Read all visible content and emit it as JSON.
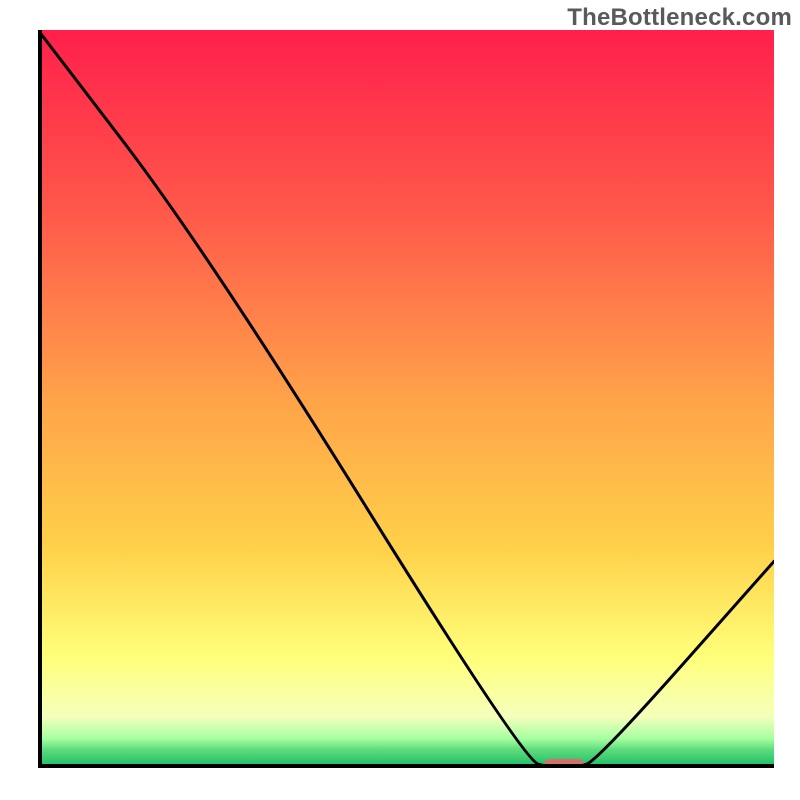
{
  "watermark": "TheBottleneck.com",
  "chart_data": {
    "type": "line",
    "title": "",
    "xlabel": "",
    "ylabel": "",
    "xlim": [
      0,
      100
    ],
    "ylim": [
      0,
      100
    ],
    "grid": false,
    "legend": false,
    "series": [
      {
        "name": "curve",
        "x": [
          0,
          23,
          66,
          70,
          73,
          76,
          100
        ],
        "y": [
          100,
          70,
          1,
          0,
          0,
          1,
          28
        ]
      }
    ],
    "marker": {
      "name": "optimal-marker",
      "x": 71.5,
      "y": 0,
      "width_percent": 5.5,
      "color": "#d56f6e"
    },
    "gradient_stops": [
      {
        "offset": 0,
        "color": "#ff1f4b"
      },
      {
        "offset": 25,
        "color": "#ff594a"
      },
      {
        "offset": 50,
        "color": "#ffa349"
      },
      {
        "offset": 70,
        "color": "#ffd049"
      },
      {
        "offset": 85,
        "color": "#ffff7a"
      },
      {
        "offset": 93,
        "color": "#f6ffbb"
      },
      {
        "offset": 96,
        "color": "#a6ffa1"
      },
      {
        "offset": 97.5,
        "color": "#5fdc7c"
      },
      {
        "offset": 99,
        "color": "#32c86e"
      },
      {
        "offset": 100,
        "color": "#1bb56a"
      }
    ],
    "axis_color": "#000000",
    "line_color": "#000000"
  }
}
